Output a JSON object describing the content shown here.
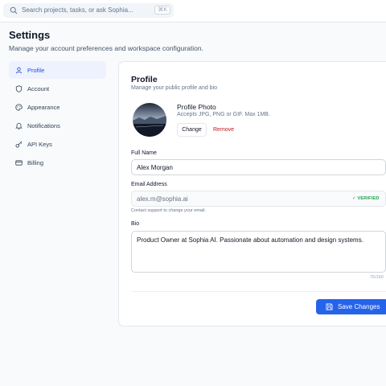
{
  "search": {
    "placeholder": "Search projects, tasks, or ask Sophia...",
    "shortcut": "⌘K"
  },
  "page": {
    "title": "Settings",
    "subtitle": "Manage your account preferences and workspace configuration."
  },
  "sidebar": {
    "items": [
      {
        "label": "Profile",
        "icon": "user-icon",
        "active": true
      },
      {
        "label": "Account",
        "icon": "shield-icon",
        "active": false
      },
      {
        "label": "Appearance",
        "icon": "palette-icon",
        "active": false
      },
      {
        "label": "Notifications",
        "icon": "bell-icon",
        "active": false
      },
      {
        "label": "API Keys",
        "icon": "key-icon",
        "active": false
      },
      {
        "label": "Billing",
        "icon": "credit-card-icon",
        "active": false
      }
    ]
  },
  "profile": {
    "title": "Profile",
    "subtitle": "Manage your public profile and bio",
    "photo": {
      "title": "Profile Photo",
      "hint": "Accepts JPG, PNG or GIF. Max 1MB.",
      "change_label": "Change",
      "remove_label": "Remove"
    },
    "full_name": {
      "label": "Full Name",
      "value": "Alex Morgan"
    },
    "email": {
      "label": "Email Address",
      "value": "alex.m@sophia.ai",
      "badge": "✓ VERIFIED",
      "helper": "Contact support to change your email."
    },
    "bio": {
      "label": "Bio",
      "value": "Product Owner at Sophia AI. Passionate about automation and design systems.",
      "counter": "75/160"
    },
    "save_label": "Save Changes"
  },
  "colors": {
    "accent": "#2563eb",
    "active_nav_bg": "#eef2ff",
    "verified": "#16a34a",
    "remove": "#b91c1c"
  }
}
